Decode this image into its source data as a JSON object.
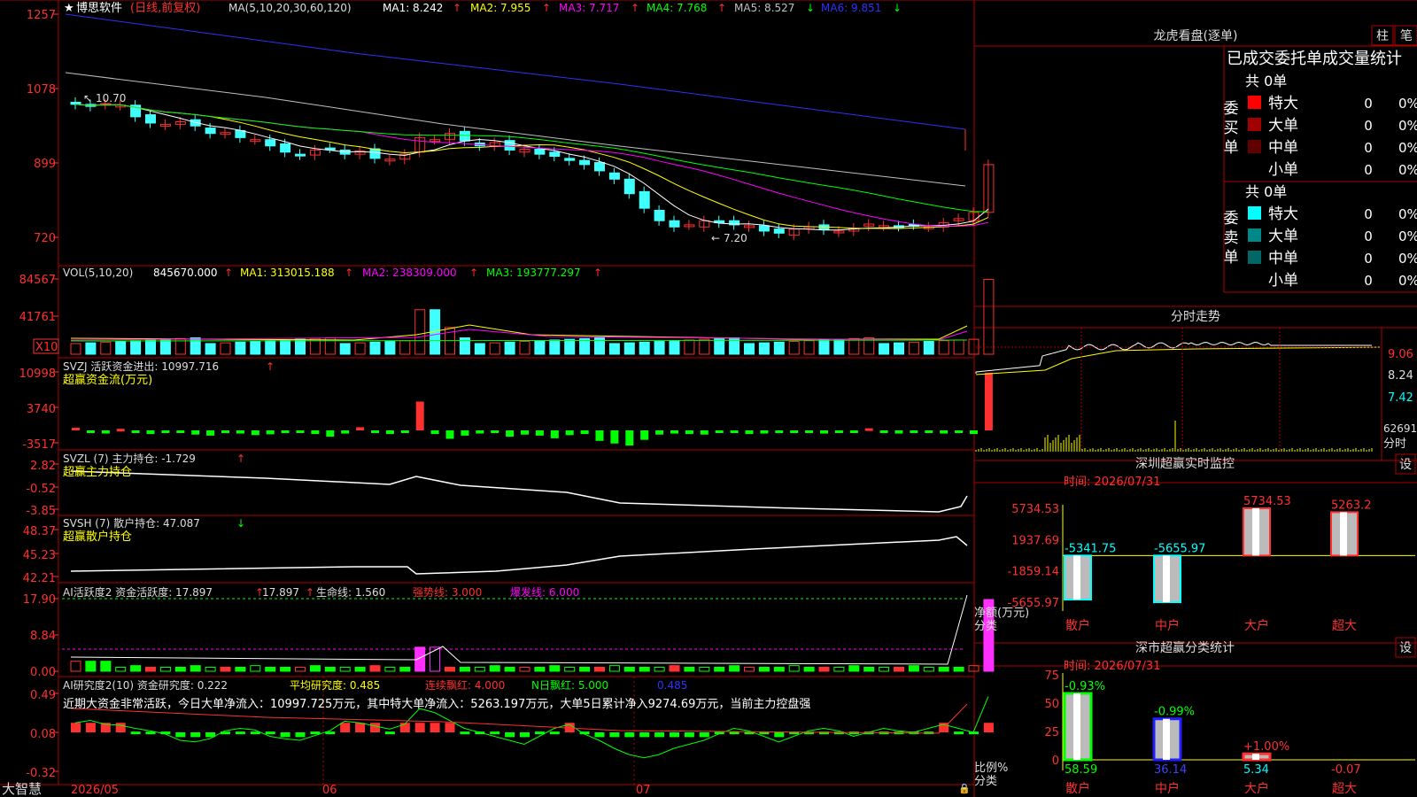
{
  "colors": {
    "up": "#ff3030",
    "down": "#40ffff",
    "grid": "#b00000",
    "text": "#c0c0c0",
    "ma1": "#ffffff",
    "ma2": "#ffff00",
    "ma3": "#ff00ff",
    "ma4": "#00ff00",
    "ma5": "#c0c0c0",
    "ma6": "#3030ff",
    "yellow": "#ffff00",
    "green": "#00ff00"
  },
  "header": {
    "star": "★",
    "stock_name": "博思软件",
    "period": "(日线,前复权)",
    "ma_params": "MA(5,10,20,30,60,120)",
    "ma1": "MA1: 8.242",
    "ma2": "MA2: 7.955",
    "ma3": "MA3: 7.717",
    "ma4": "MA4: 7.768",
    "ma5": "MA5: 8.527",
    "ma6": "MA6: 9.851",
    "ma1_arrow": "↑",
    "ma2_arrow": "↑",
    "ma3_arrow": "↑",
    "ma4_arrow": "↑",
    "ma5_arrow": "↓",
    "ma6_arrow": "↓"
  },
  "price_panel": {
    "ticks": [
      "1257",
      "1078",
      "899",
      "720"
    ],
    "tick_values": [
      12.57,
      10.78,
      8.99,
      7.2
    ],
    "high_label": "10.70",
    "low_label": "7.20"
  },
  "vol_panel": {
    "title": "VOL(5,10,20)",
    "vol": "845670.000",
    "ma1": "MA1: 313015.188",
    "ma2": "MA2: 238309.000",
    "ma3": "MA3: 193777.297",
    "arrow": "↑",
    "ticks": [
      "84567",
      "41761"
    ],
    "unit": "X10"
  },
  "svzj": {
    "title": "SVZJ  活跃资金进出: 10997.716",
    "arrow": "↑",
    "sub": "超赢资金流(万元)",
    "ticks": [
      "10998",
      "3740",
      "-3517"
    ]
  },
  "svzl": {
    "title": "SVZL (7) 主力持仓: -1.729",
    "arrow": "↑",
    "sub": "超赢主力持仓",
    "ticks": [
      "2.82",
      "-0.52",
      "-3.85"
    ]
  },
  "svsh": {
    "title": "SVSH (7) 散户持仓: 47.087",
    "arrow": "↓",
    "sub": "超赢散户持仓",
    "ticks": [
      "48.37",
      "45.23",
      "42.21"
    ]
  },
  "ai_active": {
    "title": "AI活跃度2 资金活跃度: 17.897",
    "v2": "17.897",
    "life": "生命线: 1.560",
    "strong": "强势线: 3.000",
    "burst": "爆发线: 6.000",
    "ticks": [
      "17.90",
      "8.84",
      "0.00"
    ]
  },
  "ai_research": {
    "title": "AI研究度2(10) 资金研究度: 0.222",
    "avg": "平均研究度: 0.485",
    "cont": "连续飘红: 4.000",
    "nday": "N日飘红: 5.000",
    "last": "0.485",
    "comment": "近期大资金非常活跃，今日大单净流入：10997.725万元，其中特大单净流入：5263.197万元，大单5日累计净入9274.69万元，当前主力控盘强",
    "ticks": [
      "0.49",
      "0.08",
      "-0.32"
    ]
  },
  "xaxis": {
    "brand": "大智慧",
    "labels": [
      "2026/05",
      "06",
      "07"
    ]
  },
  "right": {
    "dragon_title": "龙虎看盘(逐单)",
    "btn_zhu": "柱",
    "btn_bi": "笔",
    "table_title": "已成交委托单成交量统计",
    "buy": {
      "side": "委买单",
      "total": "共 0单",
      "rows": [
        {
          "label": "特大",
          "v": "0",
          "p": "0%",
          "c": "#ff0000"
        },
        {
          "label": "大单",
          "v": "0",
          "p": "0%",
          "c": "#a00000"
        },
        {
          "label": "中单",
          "v": "0",
          "p": "0%",
          "c": "#600000"
        },
        {
          "label": "小单",
          "v": "0",
          "p": "0%",
          "c": ""
        }
      ]
    },
    "sell": {
      "side": "委卖单",
      "total": "共 0单",
      "rows": [
        {
          "label": "特大",
          "v": "0",
          "p": "0%",
          "c": "#00ffff"
        },
        {
          "label": "大单",
          "v": "0",
          "p": "0%",
          "c": "#008888"
        },
        {
          "label": "中单",
          "v": "0",
          "p": "0%",
          "c": "#006666"
        },
        {
          "label": "小单",
          "v": "0",
          "p": "0%",
          "c": ""
        }
      ]
    },
    "intraday_title": "分时走势",
    "intraday_ticks": [
      "9.06",
      "8.24",
      "7.42"
    ],
    "intraday_vol": "62691",
    "intraday_unit": "分时",
    "sz_title": "深圳超赢实时监控",
    "btn_set": "设",
    "sz_time": "时间: 2026/07/31",
    "sz_ticks": [
      "5734.53",
      "1937.69",
      "-1859.14",
      "-5655.97"
    ],
    "sz_ylabel": "净额(万元)",
    "sz_xlabel": "分类",
    "sz_bars": [
      {
        "cat": "散户",
        "label": "-5341.75"
      },
      {
        "cat": "中户",
        "label": "-5655.97"
      },
      {
        "cat": "大户",
        "label": "5734.53"
      },
      {
        "cat": "超大",
        "label": "5263.2"
      }
    ],
    "cls_title": "深市超赢分类统计",
    "cls_time": "时间: 2026/07/31",
    "cls_ticks": [
      "75",
      "50",
      "25",
      "0"
    ],
    "cls_ylabel": "比例%",
    "cls_xlabel": "分类",
    "cls_bars": [
      {
        "cat": "散户",
        "top": "-0.93%",
        "bottom": "58.59"
      },
      {
        "cat": "中户",
        "top": "-0.99%",
        "bottom": "36.14"
      },
      {
        "cat": "大户",
        "top": "+1.00%",
        "bottom": "5.34"
      },
      {
        "cat": "超大",
        "top": "",
        "bottom": "-0.07"
      }
    ]
  },
  "chart_data": [
    {
      "type": "bar",
      "title": "深圳超赢实时监控",
      "ylabel": "净额(万元)",
      "categories": [
        "散户",
        "中户",
        "大户",
        "超大"
      ],
      "values": [
        -5341.75,
        -5655.97,
        5734.53,
        5263.2
      ],
      "ylim": [
        -5655.97,
        5734.53
      ]
    },
    {
      "type": "bar",
      "title": "深市超赢分类统计",
      "ylabel": "比例%",
      "categories": [
        "散户",
        "中户",
        "大户",
        "超大"
      ],
      "values": [
        58.59,
        36.14,
        5.34,
        -0.07
      ],
      "changes": [
        "-0.93%",
        "-0.99%",
        "+1.00%",
        ""
      ],
      "ylim": [
        0,
        75
      ]
    }
  ]
}
